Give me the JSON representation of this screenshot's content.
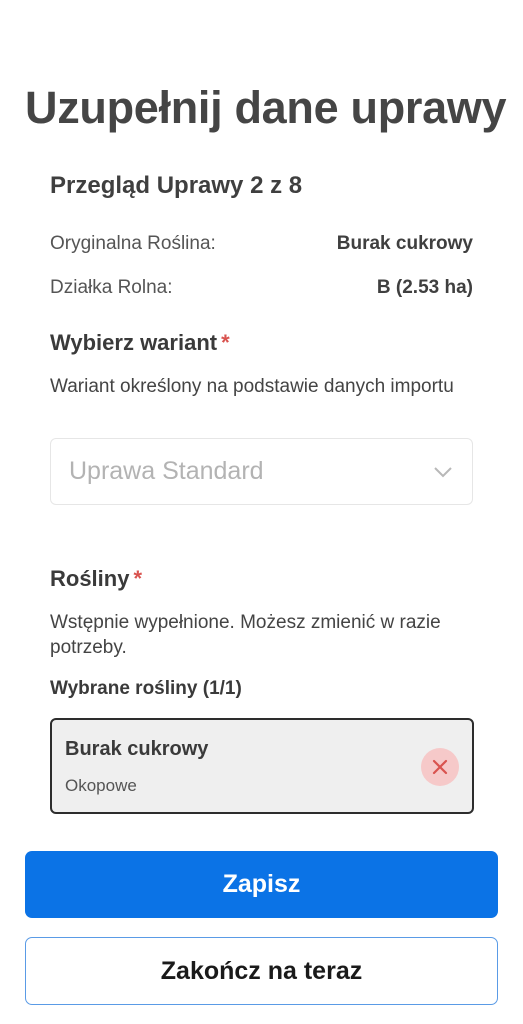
{
  "header": {
    "title": "Uzupełnij dane uprawy",
    "review": "Przegląd Uprawy 2 z 8"
  },
  "info": {
    "original_plant_label": "Oryginalna Roślina:",
    "original_plant_value": "Burak cukrowy",
    "plot_label": "Działka Rolna:",
    "plot_value": "B (2.53 ha)"
  },
  "variant": {
    "heading": "Wybierz wariant",
    "required_mark": "*",
    "description": "Wariant określony na podstawie danych importu",
    "selected": "Uprawa Standard",
    "chevron_icon": "chevron-down-icon"
  },
  "plants": {
    "heading": "Rośliny",
    "required_mark": "*",
    "description": "Wstępnie wypełnione. Możesz zmienić w razie potrzeby.",
    "selected_heading": "Wybrane rośliny (1/1)",
    "items": [
      {
        "name": "Burak cukrowy",
        "type": "Okopowe",
        "remove_icon": "close-icon"
      }
    ]
  },
  "actions": {
    "save_label": "Zapisz",
    "finish_label": "Zakończ na teraz"
  },
  "colors": {
    "primary": "#0b73e6",
    "required": "#d9534f",
    "remove_bg": "#f6c9c9"
  }
}
